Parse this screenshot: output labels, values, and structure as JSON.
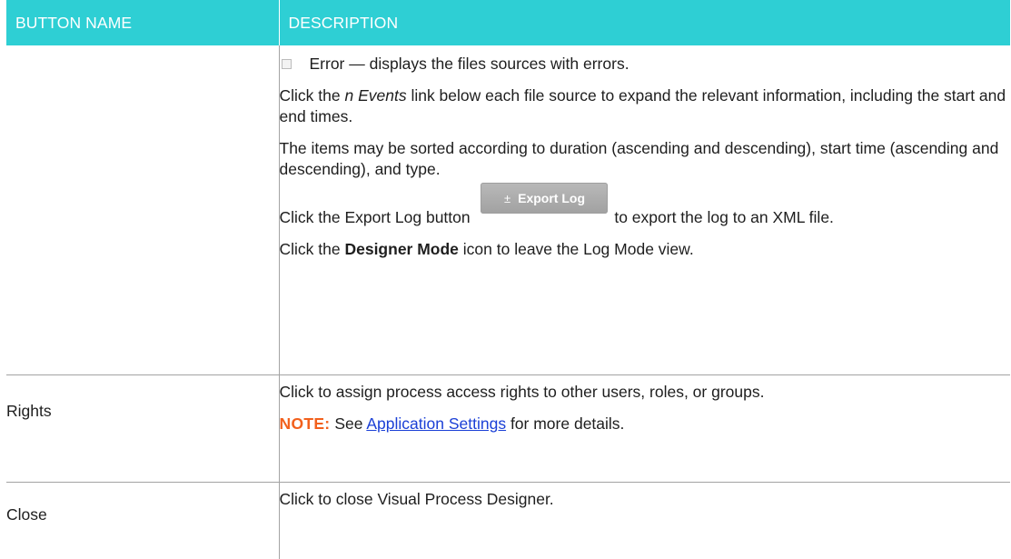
{
  "table": {
    "headers": [
      "BUTTON NAME",
      "DESCRIPTION"
    ],
    "row1": {
      "name": "",
      "bullet": "Error — displays the files sources with errors.",
      "p1_a": "Click the ",
      "p1_em": "n Events",
      "p1_b": " link below each file source to expand the relevant information, including the start and end times.",
      "p2": "The items may be sorted according to duration (ascending and descending), start time (ascending and descending), and type.",
      "p3_a": "Click the Export Log button ",
      "export_button": {
        "symbol": "±",
        "label": "Export Log"
      },
      "p3_b": " to export the log to an XML file.",
      "p4_a": "Click the ",
      "p4_strong": "Designer Mode",
      "p4_b": " icon to leave the Log Mode view."
    },
    "row2": {
      "name": "Rights",
      "desc": "Click to assign process access rights to other users, roles, or groups.",
      "note_label": "NOTE:",
      "note_a": " See ",
      "note_link": "Application Settings",
      "note_b": " for more details."
    },
    "row3": {
      "name": "Close",
      "desc": "Click to close Visual Process Designer."
    }
  },
  "colors": {
    "header_bg": "#2ecfd4",
    "note": "#f2601c",
    "link": "#1a3fd6"
  }
}
